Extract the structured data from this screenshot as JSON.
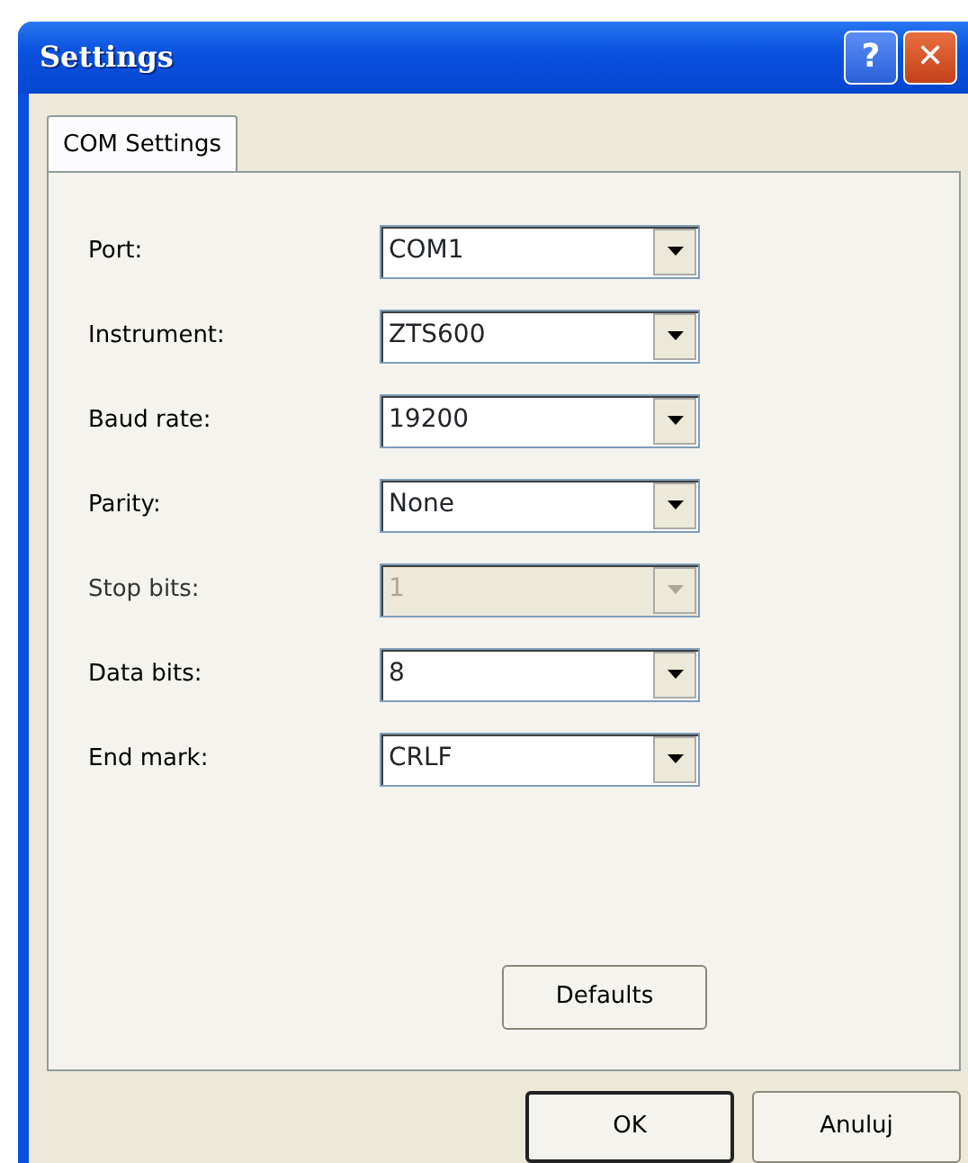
{
  "window": {
    "title": "Settings"
  },
  "title_buttons": [
    {
      "kind": "help",
      "label": "?"
    },
    {
      "kind": "close",
      "label": "✕"
    }
  ],
  "tabs": [
    {
      "label": "COM Settings",
      "selected": true
    }
  ],
  "fields": [
    {
      "label": "Port:",
      "value": "COM1",
      "disabled": false
    },
    {
      "label": "Instrument:",
      "value": "ZTS600",
      "disabled": false
    },
    {
      "label": "Baud rate:",
      "value": "19200",
      "disabled": false
    },
    {
      "label": "Parity:",
      "value": "None",
      "disabled": false
    },
    {
      "label": "Stop bits:",
      "value": "1",
      "disabled": true
    },
    {
      "label": "Data bits:",
      "value": "8",
      "disabled": false
    },
    {
      "label": "End mark:",
      "value": "CRLF",
      "disabled": false
    }
  ],
  "panel_button": "Defaults",
  "buttons": [
    {
      "label": "OK",
      "default": true
    },
    {
      "label": "Anuluj",
      "default": false
    }
  ]
}
